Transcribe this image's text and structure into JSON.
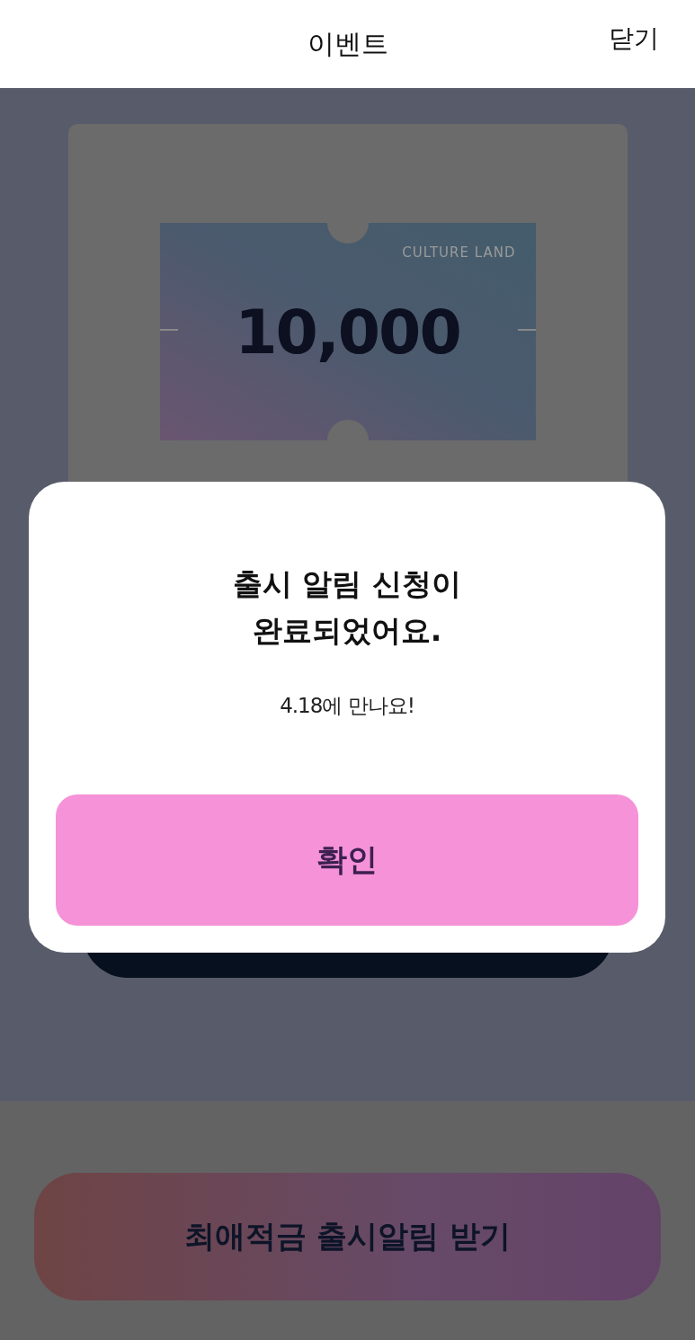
{
  "header": {
    "title": "이벤트",
    "close": "닫기"
  },
  "voucher": {
    "brand": "CULTURE LAND",
    "amount": "10,000"
  },
  "dialog": {
    "title_lines": [
      "출시 알림 신청이",
      "완료되었어요."
    ],
    "message": "4.18에 만나요!",
    "confirm": "확인"
  },
  "cta": {
    "label": "최애적금 출시알림 받기"
  }
}
